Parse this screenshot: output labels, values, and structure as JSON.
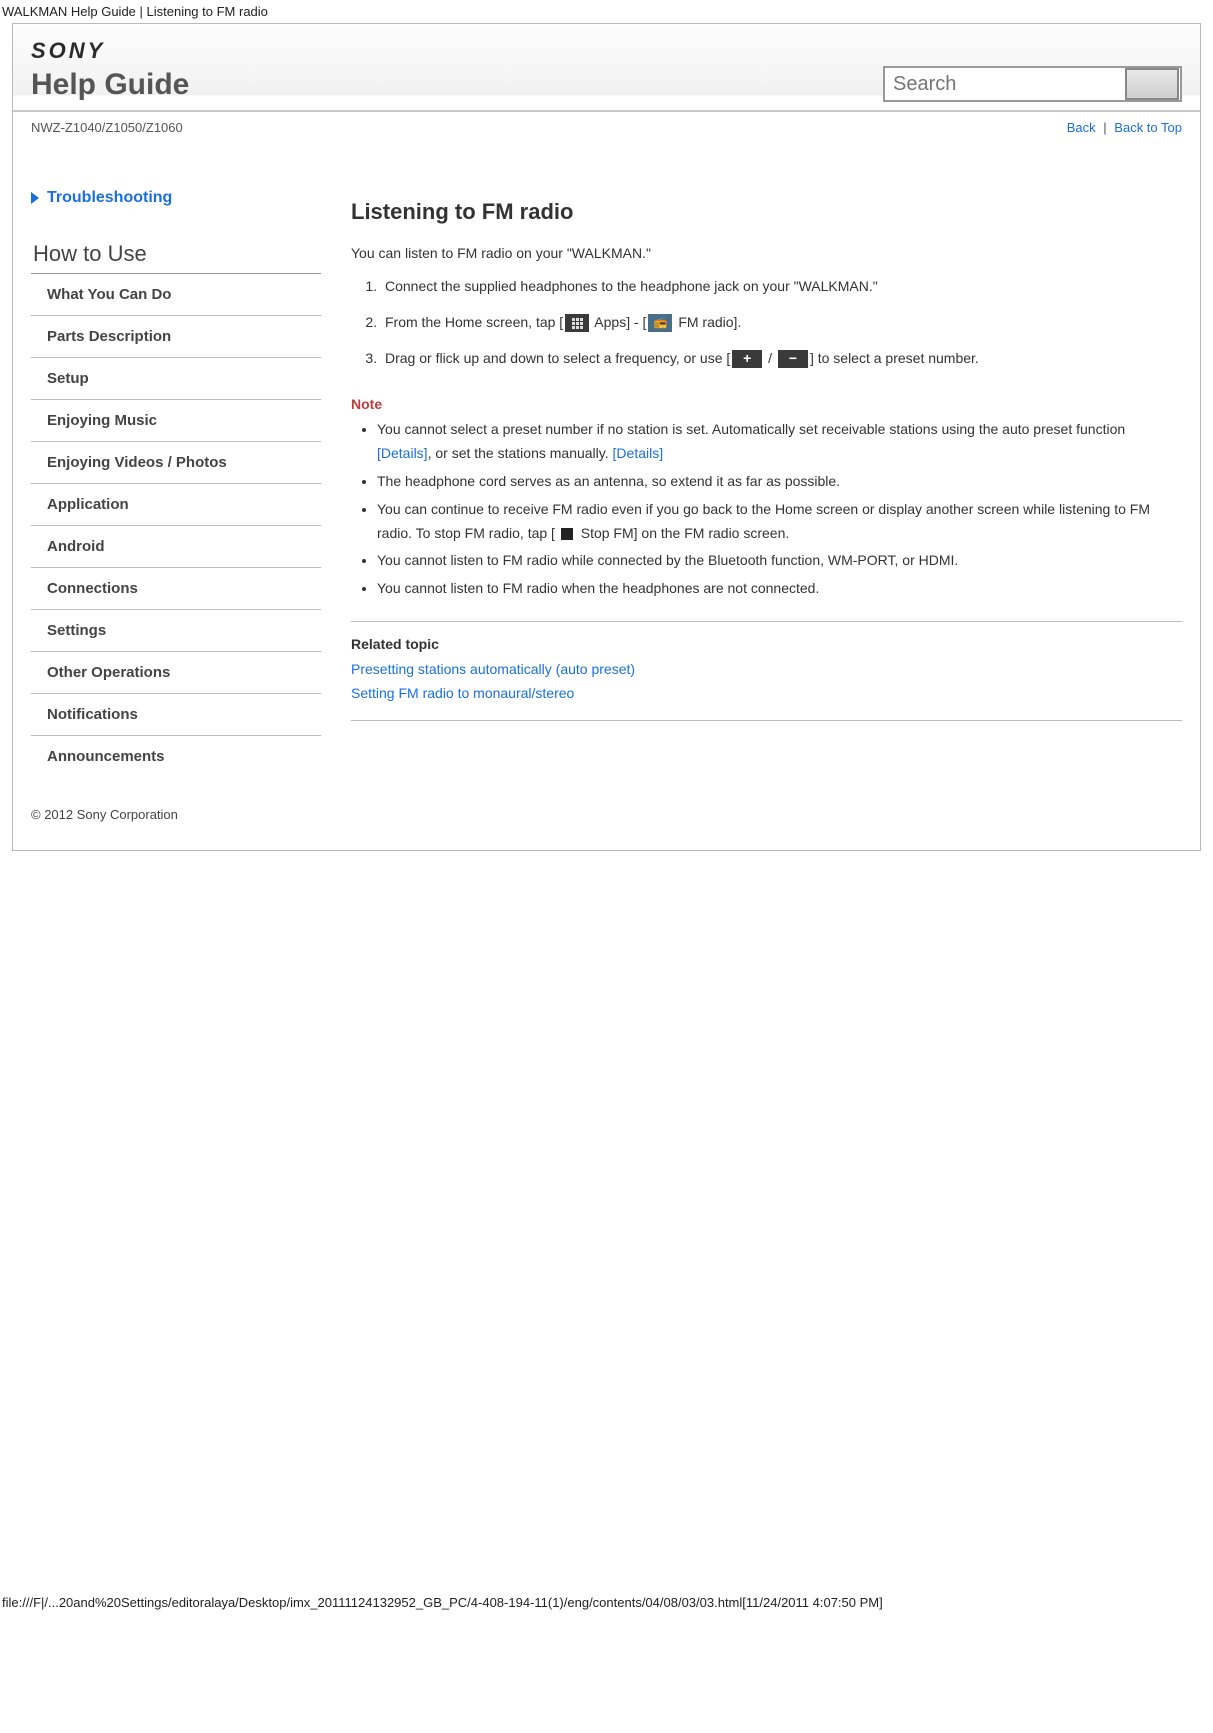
{
  "window_title": "WALKMAN Help Guide | Listening to FM radio",
  "brand": "SONY",
  "help_guide_label": "Help Guide",
  "search_placeholder": "Search",
  "model": "NWZ-Z1040/Z1050/Z1060",
  "nav": {
    "back": "Back",
    "back_to_top": "Back to Top",
    "sep": "|"
  },
  "troubleshoot": "Troubleshooting",
  "how_to_use": "How to Use",
  "menu": [
    "What You Can Do",
    "Parts Description",
    "Setup",
    "Enjoying Music",
    "Enjoying Videos / Photos",
    "Application",
    "Android",
    "Connections",
    "Settings",
    "Other Operations",
    "Notifications",
    "Announcements"
  ],
  "article": {
    "title": "Listening to FM radio",
    "intro": "You can listen to FM radio on your \"WALKMAN.\"",
    "steps": {
      "s1": "Connect the supplied headphones to the headphone jack on your \"WALKMAN.\"",
      "s2a": "From the Home screen, tap [",
      "s2b": " Apps] - [",
      "s2c": " FM radio].",
      "s3a": "Drag or flick up and down to select a frequency, or use [",
      "s3b": " / ",
      "s3c": "] to select a preset number."
    },
    "note_head": "Note",
    "notes": {
      "n1a": "You cannot select a preset number if no station is set. Automatically set receivable stations using the auto preset function ",
      "n1b": "[Details]",
      "n1c": ", or set the stations manually. ",
      "n1d": "[Details]",
      "n2": "The headphone cord serves as an antenna, so extend it as far as possible.",
      "n3a": "You can continue to receive FM radio even if you go back to the Home screen or display another screen while listening to FM radio. To stop FM radio, tap [ ",
      "n3b": " Stop FM] on the FM radio screen.",
      "n4": "You cannot listen to FM radio while connected by the Bluetooth function, WM-PORT, or HDMI.",
      "n5": "You cannot listen to FM radio when the headphones are not connected."
    },
    "related_head": "Related topic",
    "related": [
      "Presetting stations automatically (auto preset)",
      "Setting FM radio to monaural/stereo"
    ]
  },
  "copyright": "© 2012 Sony Corporation",
  "footer_path": "file:///F|/...20and%20Settings/editoralaya/Desktop/imx_20111124132952_GB_PC/4-408-194-11(1)/eng/contents/04/08/03/03.html[11/24/2011 4:07:50 PM]"
}
